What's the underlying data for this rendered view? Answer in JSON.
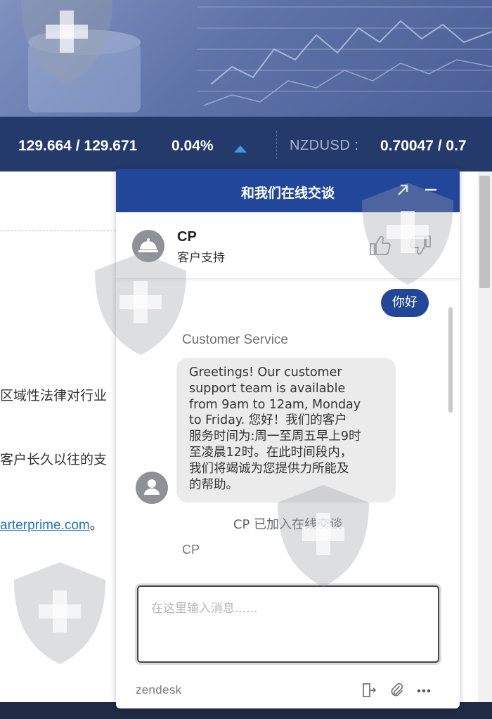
{
  "ticker": {
    "pair1_bid_ask": "129.664 / 129.671",
    "pair1_change": "0.04%",
    "pair2_label": "NZDUSD :",
    "pair2_bid": "0.70047 / 0.7"
  },
  "page": {
    "line1": "区域性法律对行业",
    "line2": "客户长久以往的支",
    "link_text": "arterprime.com",
    "link_suffix": "。"
  },
  "chat": {
    "header_title": "和我们在线交谈",
    "agent_name": "CP",
    "agent_role": "客户支持",
    "messages": {
      "user_message": "你好",
      "agent_sender": "Customer Service",
      "agent_lines": [
        "Greetings! Our customer",
        "support team is available",
        "from 9am to 12am, Monday",
        "to Friday. 您好！我们的客户",
        "服务时间为:周一至周五早上9时",
        "至凌晨12时。在此时间段内，",
        "我们将竭诚为您提供力所能及",
        "的帮助。"
      ],
      "system_note": "CP 已加入在线交谈",
      "typing_sender": "CP"
    },
    "composer_placeholder": "在这里输入消息......",
    "brand": "zendesk"
  },
  "colors": {
    "brand_blue": "#22469a",
    "ticker_bg": "#243a6a",
    "up_arrow": "#3c9be0",
    "link": "#1e73c8"
  },
  "icons": {
    "expand": "arrow-up-right",
    "minimize": "minus",
    "agent_avatar": "concierge-bell",
    "thumbs_up": "thumbs-up",
    "thumbs_down": "thumbs-down",
    "user_avatar": "person",
    "end_chat": "exit-door",
    "attach": "paperclip",
    "more": "ellipsis"
  }
}
